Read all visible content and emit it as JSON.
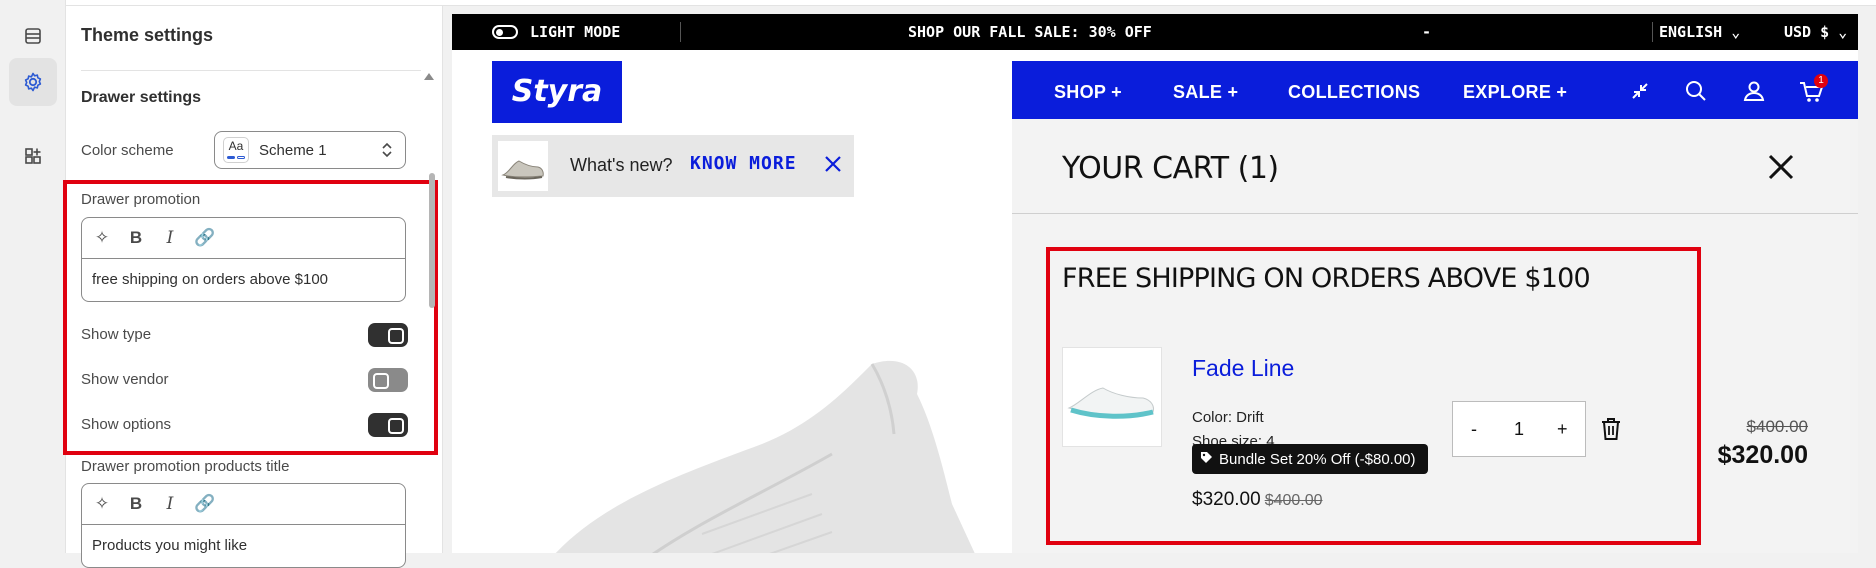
{
  "sidebar_rail": {
    "items": [
      {
        "name": "sections-icon"
      },
      {
        "name": "theme-settings-icon",
        "active": true
      },
      {
        "name": "apps-icon"
      }
    ]
  },
  "panel": {
    "title": "Theme settings",
    "section_title": "Drawer settings",
    "color_scheme": {
      "label": "Color scheme",
      "swatch": "Aa",
      "value": "Scheme 1"
    },
    "drawer_promotion": {
      "label": "Drawer promotion",
      "value": "free shipping on orders above $100"
    },
    "toggles": [
      {
        "label": "Show type",
        "on": true
      },
      {
        "label": "Show vendor",
        "on": false
      },
      {
        "label": "Show options",
        "on": true
      }
    ],
    "products_title": {
      "label": "Drawer promotion products title",
      "value": "Products you might like"
    }
  },
  "preview": {
    "topbar": {
      "light_mode": "LIGHT MODE",
      "sale": "SHOP OUR FALL SALE: 30% OFF",
      "dash": "-",
      "language": "ENGLISH",
      "currency": "USD $"
    },
    "logo": "Ѕtyra",
    "nav": [
      {
        "label": "SHOP +"
      },
      {
        "label": "SALE +"
      },
      {
        "label": "COLLECTIONS"
      },
      {
        "label": "EXPLORE +"
      }
    ],
    "cart_count": "1",
    "whats_new": {
      "text": "What's new?",
      "link": "KNOW MORE"
    },
    "cart": {
      "title": "YOUR CART (1)",
      "promo": "FREE SHIPPING ON ORDERS ABOVE $100",
      "product": {
        "name": "Fade Line",
        "color": "Color: Drift",
        "size": "Shoe size: 4",
        "badge": "Bundle Set 20% Off (-$80.00)",
        "price": "$320.00",
        "compare_price": "$400.00",
        "quantity": "1",
        "minus": "-",
        "plus": "+",
        "line_old": "$400.00",
        "line_new": "$320.00"
      }
    }
  },
  "colors": {
    "accent_blue": "#0a1ddb",
    "highlight_red": "#e0000f"
  }
}
